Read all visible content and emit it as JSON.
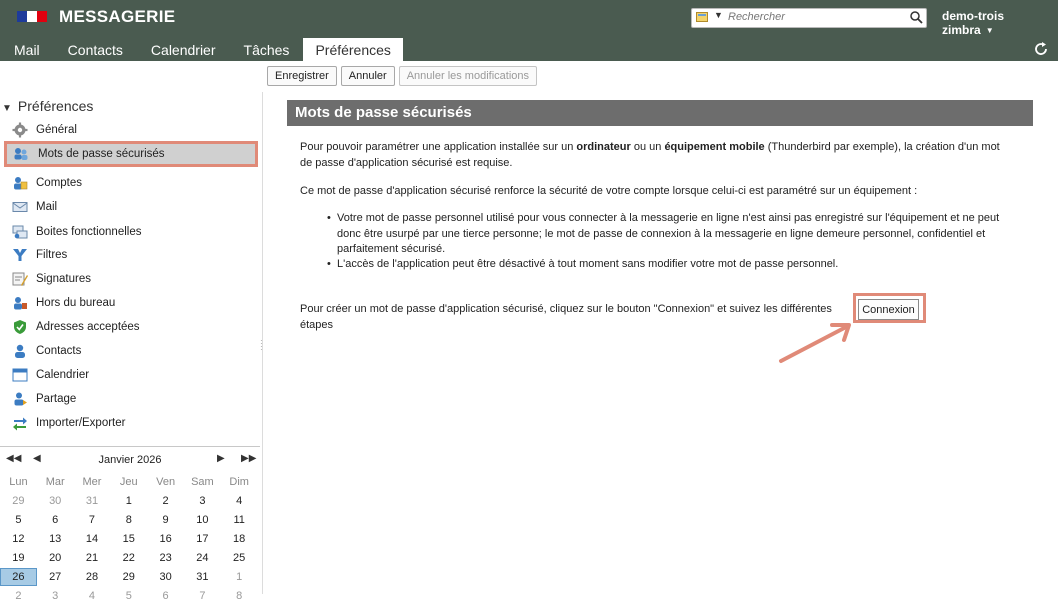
{
  "header": {
    "brand": "MESSAGERIE",
    "search_placeholder": "Rechercher",
    "user": "demo-trois zimbra",
    "tabs": [
      {
        "label": "Mail"
      },
      {
        "label": "Contacts"
      },
      {
        "label": "Calendrier"
      },
      {
        "label": "Tâches"
      },
      {
        "label": "Préférences"
      }
    ],
    "active_tab": "Préférences",
    "flag_colors": [
      "#1e3b9b",
      "#ffffff",
      "#e1000f"
    ],
    "background_color": "#4a5b50"
  },
  "toolbar": {
    "save": "Enregistrer",
    "cancel": "Annuler",
    "undo": "Annuler les modifications"
  },
  "sidebar": {
    "header": "Préférences",
    "items": [
      {
        "label": "Général",
        "icon": "gear-icon"
      },
      {
        "label": "Mots de passe sécurisés",
        "icon": "key-users-icon"
      },
      {
        "label": "Comptes",
        "icon": "accounts-icon"
      },
      {
        "label": "Mail",
        "icon": "mail-icon"
      },
      {
        "label": "Boites fonctionnelles",
        "icon": "mailboxes-icon"
      },
      {
        "label": "Filtres",
        "icon": "filter-icon"
      },
      {
        "label": "Signatures",
        "icon": "signature-icon"
      },
      {
        "label": "Hors du bureau",
        "icon": "out-of-office-icon"
      },
      {
        "label": "Adresses acceptées",
        "icon": "shield-check-icon"
      },
      {
        "label": "Contacts",
        "icon": "contact-icon"
      },
      {
        "label": "Calendrier",
        "icon": "calendar-icon"
      },
      {
        "label": "Partage",
        "icon": "share-icon"
      },
      {
        "label": "Importer/Exporter",
        "icon": "import-export-icon"
      }
    ],
    "selected": "Mots de passe sécurisés"
  },
  "calendar": {
    "title": "Janvier 2026",
    "weekdays": [
      "Lun",
      "Mar",
      "Mer",
      "Jeu",
      "Ven",
      "Sam",
      "Dim"
    ],
    "weeks": [
      [
        "29",
        "30",
        "31",
        "1",
        "2",
        "3",
        "4"
      ],
      [
        "5",
        "6",
        "7",
        "8",
        "9",
        "10",
        "11"
      ],
      [
        "12",
        "13",
        "14",
        "15",
        "16",
        "17",
        "18"
      ],
      [
        "19",
        "20",
        "21",
        "22",
        "23",
        "24",
        "25"
      ],
      [
        "26",
        "27",
        "28",
        "29",
        "30",
        "31",
        "1"
      ],
      [
        "2",
        "3",
        "4",
        "5",
        "6",
        "7",
        "8"
      ]
    ],
    "today": "26"
  },
  "content": {
    "title": "Mots de passe sécurisés",
    "p1_a": "Pour pouvoir paramétrer une application installée sur un ",
    "p1_b": "ordinateur",
    "p1_c": " ou un ",
    "p1_d": "équipement mobile",
    "p1_e": " (Thunderbird par exemple), la création d'un mot de passe d'application sécurisé est requise.",
    "p2": "Ce mot de passe d'application sécurisé renforce la sécurité de votre compte lorsque celui-ci est paramétré sur un équipement :",
    "bullet1": "Votre mot de passe personnel utilisé pour vous connecter à la messagerie en ligne n'est ainsi pas enregistré sur l'équipement et ne peut donc être usurpé par une tierce personne; le mot de passe de connexion à la messagerie en ligne demeure personnel, confidentiel et parfaitement sécurisé.",
    "bullet2": "L'accès de l'application peut être désactivé à tout moment sans modifier votre mot de passe personnel.",
    "p3": "Pour créer un mot de passe d'application sécurisé, cliquez sur le bouton \"Connexion\" et suivez les différentes étapes",
    "button": "Connexion"
  },
  "highlight_color": "#e08a78"
}
